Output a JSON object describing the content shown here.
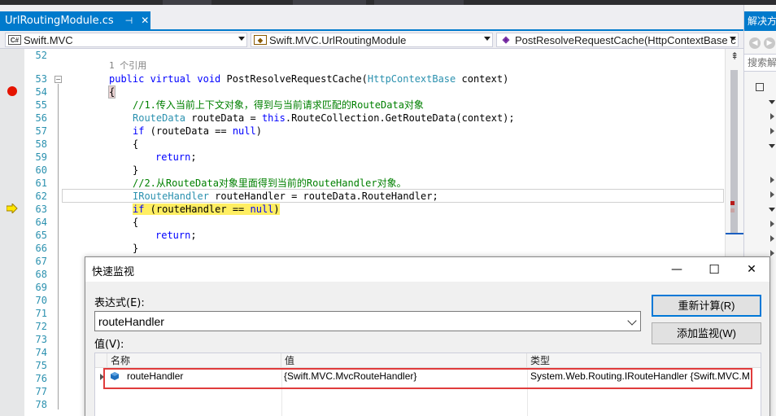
{
  "tab": {
    "title": "UrlRoutingModule.cs",
    "pin_icon": "pin-icon",
    "close_icon": "close-icon",
    "accent": "#007ACC"
  },
  "nav": {
    "project": "Swift.MVC",
    "class": "Swift.MVC.UrlRoutingModule",
    "member": "PostResolveRequestCache(HttpContextBase c",
    "project_icon": "csharp-project-icon",
    "class_icon": "class-icon",
    "member_icon": "method-icon"
  },
  "editor": {
    "line_numbers": [
      "52",
      "53",
      "54",
      "55",
      "56",
      "57",
      "58",
      "59",
      "60",
      "61",
      "62",
      "63",
      "64",
      "65",
      "66",
      "67",
      "68",
      "69",
      "70",
      "71",
      "72",
      "73",
      "74",
      "75",
      "76",
      "77",
      "78"
    ],
    "codelens": "1 个引用",
    "lines": {
      "l53_kw": "public virtual void ",
      "l53_name": "PostResolveRequestCache(",
      "l53_type": "HttpContextBase",
      "l53_rest": " context)",
      "l54": "{",
      "l55": "//1.传入当前上下文对象，得到与当前请求匹配的RouteData对象",
      "l56_type": "RouteData",
      "l56_mid": " routeData = ",
      "l56_kw": "this",
      "l56_rest": ".RouteCollection.GetRouteData(context);",
      "l57_kw": "if",
      "l57_a": " (routeData == ",
      "l57_null": "null",
      "l57_b": ")",
      "l58": "{",
      "l59_kw": "return",
      "l59_rest": ";",
      "l60": "}",
      "l61": "//2.从RouteData对象里面得到当前的RouteHandler对象。",
      "l62_type": "IRouteHandler",
      "l62_rest": " routeHandler = routeData.RouteHandler;",
      "l63_kw": "if",
      "l63_a": " (routeHandler == ",
      "l63_null": "null",
      "l63_b": ")",
      "l64": "{",
      "l65_kw": "return",
      "l65_rest": ";",
      "l66": "}"
    },
    "breakpoint_color": "#E51400",
    "current_stmt_color": "#FFEE62"
  },
  "solution_explorer": {
    "title": "解决方",
    "search_placeholder": "搜索解"
  },
  "quickwatch": {
    "title": "快速监视",
    "expression_label": "表达式(E):",
    "expression_value": "routeHandler",
    "value_label": "值(V):",
    "recalc_button": "重新计算(R)",
    "add_watch_button": "添加监视(W)",
    "columns": [
      "名称",
      "值",
      "类型"
    ],
    "rows": [
      {
        "name": "routeHandler",
        "value": "{Swift.MVC.MvcRouteHandler}",
        "type": "System.Web.Routing.IRouteHandler {Swift.MVC.M"
      }
    ],
    "minimize_glyph": "—",
    "maximize_glyph": "☐",
    "close_glyph": "✕",
    "highlight_color": "#E03C3C"
  }
}
